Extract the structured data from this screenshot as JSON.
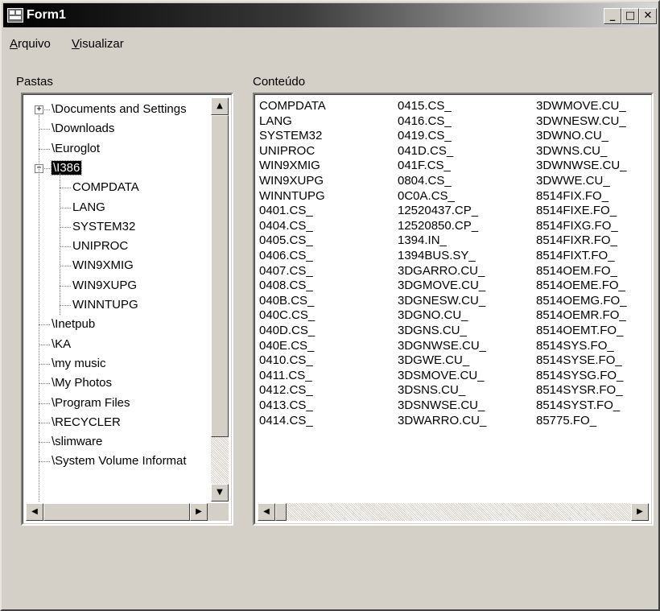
{
  "window": {
    "title": "Form1",
    "caption_buttons": {
      "minimize": "_",
      "maximize": "□",
      "close": "✕"
    }
  },
  "menu": {
    "items": [
      {
        "label": "Arquivo",
        "mnemonic": "A",
        "rest": "rquivo"
      },
      {
        "label": "Visualizar",
        "mnemonic": "V",
        "rest": "isualizar"
      }
    ]
  },
  "folders_panel": {
    "label": "Pastas",
    "tree": [
      {
        "label": "\\Documents and Settings",
        "level": 0,
        "expander": "+"
      },
      {
        "label": "\\Downloads",
        "level": 0
      },
      {
        "label": "\\Euroglot",
        "level": 0
      },
      {
        "label": "\\I386",
        "level": 0,
        "expander": "−",
        "selected": true
      },
      {
        "label": "COMPDATA",
        "level": 1
      },
      {
        "label": "LANG",
        "level": 1
      },
      {
        "label": "SYSTEM32",
        "level": 1
      },
      {
        "label": "UNIPROC",
        "level": 1
      },
      {
        "label": "WIN9XMIG",
        "level": 1
      },
      {
        "label": "WIN9XUPG",
        "level": 1
      },
      {
        "label": "WINNTUPG",
        "level": 1
      },
      {
        "label": "\\Inetpub",
        "level": 0
      },
      {
        "label": "\\KA",
        "level": 0
      },
      {
        "label": "\\my music",
        "level": 0
      },
      {
        "label": "\\My Photos",
        "level": 0
      },
      {
        "label": "\\Program Files",
        "level": 0
      },
      {
        "label": "\\RECYCLER",
        "level": 0
      },
      {
        "label": "\\slimware",
        "level": 0
      },
      {
        "label": "\\System Volume Informat",
        "level": 0
      }
    ],
    "scroll": {
      "up": "▲",
      "down": "▼",
      "left": "◀",
      "right": "▶"
    }
  },
  "content_panel": {
    "label": "Conteúdo",
    "columns": [
      [
        "COMPDATA",
        "LANG",
        "SYSTEM32",
        "UNIPROC",
        "WIN9XMIG",
        "WIN9XUPG",
        "WINNTUPG",
        "0401.CS_",
        "0404.CS_",
        "0405.CS_",
        "0406.CS_",
        "0407.CS_",
        "0408.CS_",
        "040B.CS_",
        "040C.CS_",
        "040D.CS_",
        "040E.CS_",
        "0410.CS_",
        "0411.CS_",
        "0412.CS_",
        "0413.CS_",
        "0414.CS_"
      ],
      [
        "0415.CS_",
        "0416.CS_",
        "0419.CS_",
        "041D.CS_",
        "041F.CS_",
        "0804.CS_",
        "0C0A.CS_",
        "12520437.CP_",
        "12520850.CP_",
        "1394.IN_",
        "1394BUS.SY_",
        "3DGARRO.CU_",
        "3DGMOVE.CU_",
        "3DGNESW.CU_",
        "3DGNO.CU_",
        "3DGNS.CU_",
        "3DGNWSE.CU_",
        "3DGWE.CU_",
        "3DSMOVE.CU_",
        "3DSNS.CU_",
        "3DSNWSE.CU_",
        "3DWARRO.CU_"
      ],
      [
        "3DWMOVE.CU_",
        "3DWNESW.CU_",
        "3DWNO.CU_",
        "3DWNS.CU_",
        "3DWNWSE.CU_",
        "3DWWE.CU_",
        "8514FIX.FO_",
        "8514FIXE.FO_",
        "8514FIXG.FO_",
        "8514FIXR.FO_",
        "8514FIXT.FO_",
        "8514OEM.FO_",
        "8514OEME.FO_",
        "8514OEMG.FO_",
        "8514OEMR.FO_",
        "8514OEMT.FO_",
        "8514SYS.FO_",
        "8514SYSE.FO_",
        "8514SYSG.FO_",
        "8514SYSR.FO_",
        "8514SYST.FO_",
        "85775.FO_"
      ]
    ],
    "scroll": {
      "left": "◀",
      "right": "▶"
    }
  }
}
